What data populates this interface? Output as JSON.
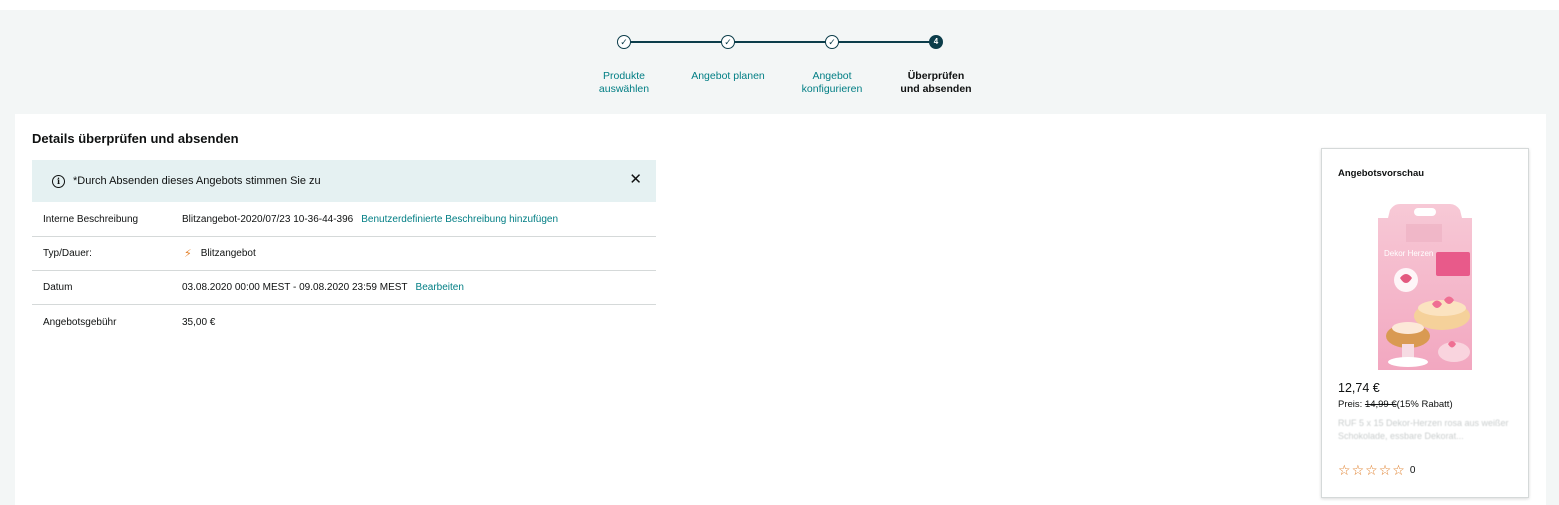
{
  "stepper": {
    "steps": [
      {
        "label": "Produkte\nauswählen",
        "marker": "✓",
        "state": "done"
      },
      {
        "label": "Angebot planen",
        "marker": "✓",
        "state": "done"
      },
      {
        "label": "Angebot\nkonfigurieren",
        "marker": "✓",
        "state": "done"
      },
      {
        "label": "Überprüfen\nund absenden",
        "marker": "4",
        "state": "active"
      }
    ]
  },
  "main": {
    "title": "Details überprüfen und absenden",
    "alert": {
      "icon": "info-icon",
      "text": "*Durch Absenden dieses Angebots stimmen Sie zu",
      "close_icon": "close-icon"
    },
    "details": [
      {
        "label": "Interne Beschreibung",
        "value": "Blitzangebot-2020/07/23 10-36-44-396",
        "link": "Benutzerdefinierte Beschreibung hinzufügen"
      },
      {
        "label": "Typ/Dauer:",
        "value": "Blitzangebot",
        "icon": "lightning-bolt-icon"
      },
      {
        "label": "Datum",
        "value": "03.08.2020 00:00 MEST - 09.08.2020 23:59 MEST",
        "link": "Bearbeiten"
      },
      {
        "label": "Angebotsgebühr",
        "value": "35,00 €"
      }
    ]
  },
  "preview": {
    "title": "Angebotsvorschau",
    "price": "12,74 €",
    "price_label": "Preis:",
    "old_price": "14,99 €",
    "discount": "(15% Rabatt)",
    "product_title": "RUF 5 x 15 Dekor-Herzen rosa aus weißer Schokolade, essbare Dekorat...",
    "product_image_text": "Dekor Herzen",
    "rating_count": "0",
    "star_count": 5
  },
  "colors": {
    "accent": "#017e84",
    "step_dark": "#0c3d4a",
    "alert_bg": "#e5f1f2",
    "star": "#de7921",
    "bolt": "#e3812b"
  }
}
